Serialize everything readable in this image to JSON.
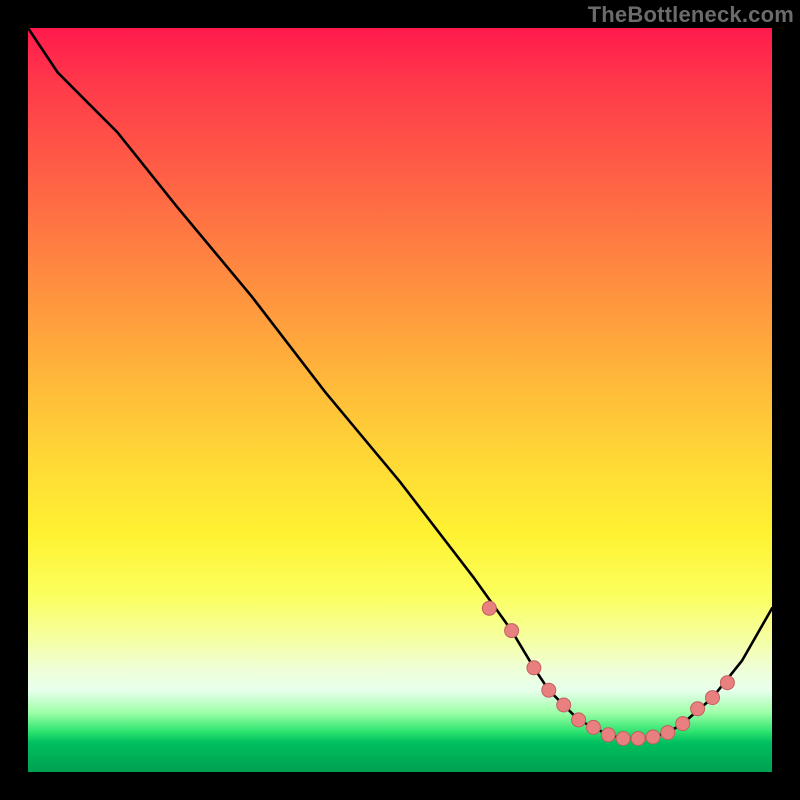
{
  "watermark": "TheBottleneck.com",
  "colors": {
    "curve": "#000000",
    "marker_fill": "#e98080",
    "marker_stroke": "#c06060"
  },
  "chart_data": {
    "type": "line",
    "title": "",
    "xlabel": "",
    "ylabel": "",
    "xlim": [
      0,
      100
    ],
    "ylim": [
      0,
      100
    ],
    "series": [
      {
        "name": "curve",
        "x": [
          0,
          4,
          8,
          12,
          20,
          30,
          40,
          50,
          60,
          65,
          68,
          70,
          72,
          74,
          76,
          78,
          80,
          82,
          84,
          86,
          88,
          92,
          96,
          100
        ],
        "y": [
          100,
          94,
          90,
          86,
          76,
          64,
          51,
          39,
          26,
          19,
          14,
          11,
          9,
          7,
          6,
          5,
          4.5,
          4.5,
          4.7,
          5.3,
          6.5,
          10,
          15,
          22
        ],
        "markers_x": [
          62,
          65,
          68,
          70,
          72,
          74,
          76,
          78,
          80,
          82,
          84,
          86,
          88,
          90,
          92,
          94
        ],
        "markers_y": [
          22,
          19,
          14,
          11,
          9,
          7,
          6,
          5,
          4.5,
          4.5,
          4.7,
          5.3,
          6.5,
          8.5,
          10,
          12
        ]
      }
    ]
  }
}
